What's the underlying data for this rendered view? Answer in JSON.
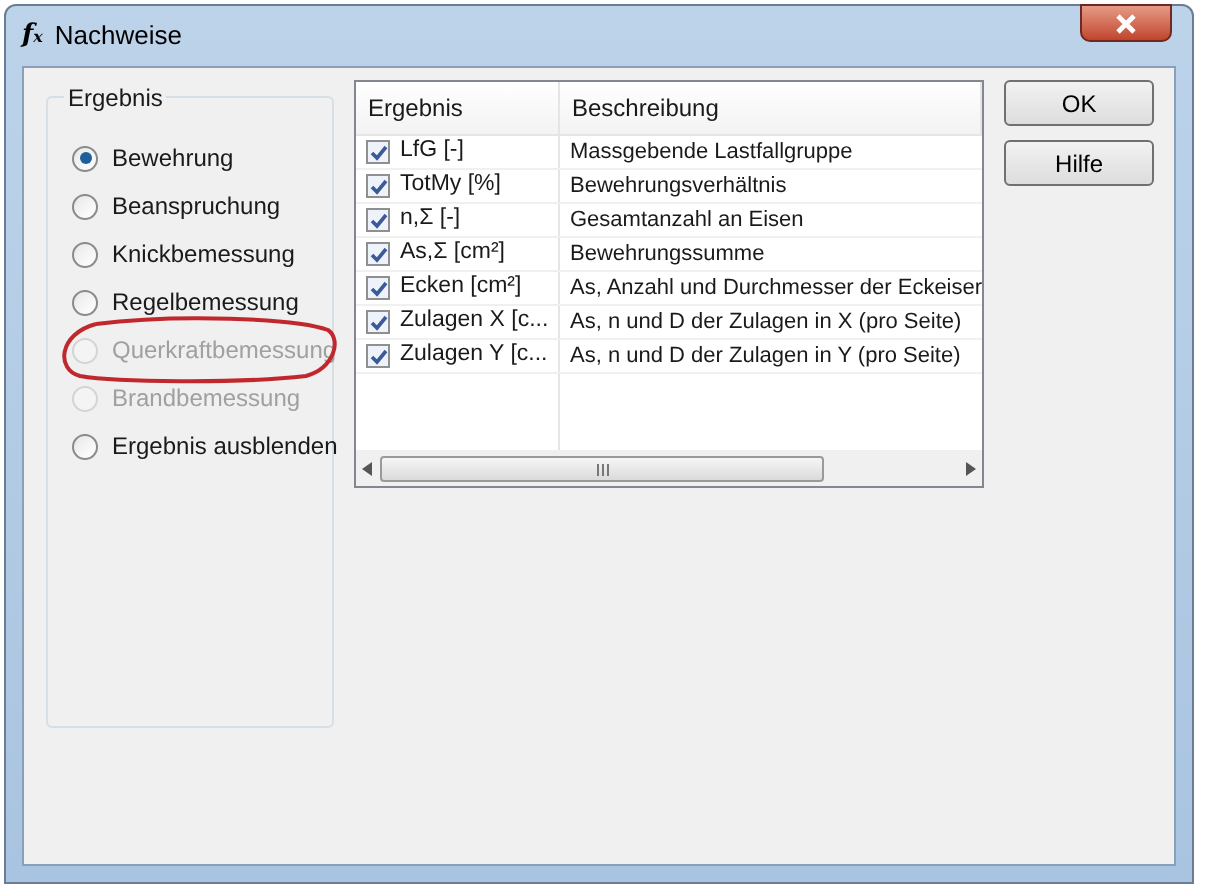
{
  "window": {
    "icon": [
      "f",
      "x"
    ],
    "title": "Nachweise"
  },
  "result_group": {
    "title": "Ergebnis",
    "options": [
      {
        "label": "Bewehrung",
        "selected": true,
        "disabled": false,
        "highlighted": false
      },
      {
        "label": "Beanspruchung",
        "selected": false,
        "disabled": false,
        "highlighted": false
      },
      {
        "label": "Knickbemessung",
        "selected": false,
        "disabled": false,
        "highlighted": false
      },
      {
        "label": "Regelbemessung",
        "selected": false,
        "disabled": false,
        "highlighted": false
      },
      {
        "label": "Querkraftbemessung",
        "selected": false,
        "disabled": true,
        "highlighted": true
      },
      {
        "label": "Brandbemessung",
        "selected": false,
        "disabled": true,
        "highlighted": false
      },
      {
        "label": "Ergebnis ausblenden",
        "selected": false,
        "disabled": false,
        "highlighted": false
      }
    ]
  },
  "table": {
    "columns": [
      "Ergebnis",
      "Beschreibung"
    ],
    "rows": [
      {
        "checked": true,
        "cells": [
          "LfG [-]",
          "Massgebende Lastfallgruppe"
        ]
      },
      {
        "checked": true,
        "cells": [
          "TotMy [%]",
          "Bewehrungsverhältnis"
        ]
      },
      {
        "checked": true,
        "cells": [
          "n,Σ [-]",
          "Gesamtanzahl an Eisen"
        ]
      },
      {
        "checked": true,
        "cells": [
          "As,Σ [cm²]",
          "Bewehrungssumme"
        ]
      },
      {
        "checked": true,
        "cells": [
          "Ecken [cm²]",
          "As, Anzahl und Durchmesser der Eckeiser"
        ]
      },
      {
        "checked": true,
        "cells": [
          "Zulagen X [c...",
          "As, n und D der Zulagen in X (pro Seite)"
        ]
      },
      {
        "checked": true,
        "cells": [
          "Zulagen Y [c...",
          "As, n und D der Zulagen in Y (pro Seite)"
        ]
      }
    ]
  },
  "buttons": [
    "OK",
    "Hilfe"
  ]
}
